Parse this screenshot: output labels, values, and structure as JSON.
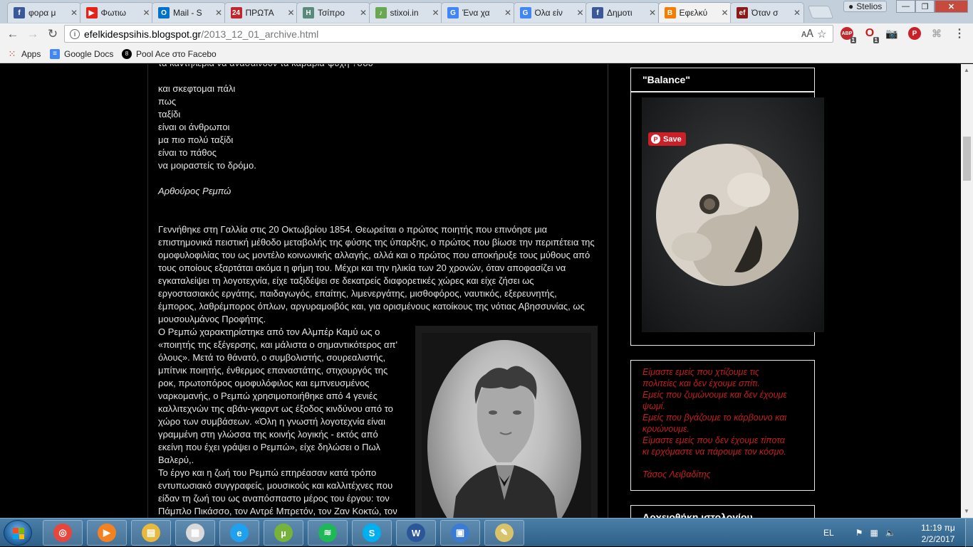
{
  "tabs": [
    {
      "label": "φορα μ",
      "icon": "f",
      "color": "#3b5998"
    },
    {
      "label": "Φωτιω",
      "icon": "▶",
      "color": "#e62117"
    },
    {
      "label": "Mail - S",
      "icon": "O",
      "color": "#0072c6"
    },
    {
      "label": "ΠΡΩΤΑ",
      "icon": "24",
      "color": "#c0262c"
    },
    {
      "label": "Τσίπρο",
      "icon": "H",
      "color": "#5a8a7a"
    },
    {
      "label": "stixoi.in",
      "icon": "♪",
      "color": "#6aa84f"
    },
    {
      "label": "Ένα χα",
      "icon": "G",
      "color": "#4285f4"
    },
    {
      "label": "Όλα είν",
      "icon": "G",
      "color": "#4285f4"
    },
    {
      "label": "Δημοτι",
      "icon": "f",
      "color": "#3b5998"
    },
    {
      "label": "Εφελκύ",
      "icon": "B",
      "color": "#f57d00",
      "active": true
    },
    {
      "label": "Όταν σ",
      "icon": "ef",
      "color": "#8b1a1a"
    }
  ],
  "profile_name": "Stelios",
  "address": {
    "host": "efelkidespsihis.blogspot.gr",
    "path": "/2013_12_01_archive.html"
  },
  "bookmarks": [
    {
      "label": "Apps",
      "icon": "apps-grid"
    },
    {
      "label": "Google Docs",
      "icon": "docs"
    },
    {
      "label": "Pool Ace στο Facebo",
      "icon": "8-ball"
    }
  ],
  "extension_badges": {
    "abp": "1",
    "opera": "1"
  },
  "post": {
    "cut_line": "τα καντηλέρια να ανασαίνουν τα καράβια-ψυχή ?σου",
    "poem_lines": [
      "και σκεφτομαι πάλι",
      "πως",
      "ταξίδι",
      "είναι οι άνθρωποι",
      "μα πιο πολύ ταξίδι",
      "είναι το πάθος",
      "να μοιραστείς το δρόμο."
    ],
    "author": "Αρθούρος Ρεμπώ",
    "bio_lines": [
      "Γεννήθηκε στη Γαλλία στις 20 Οκτωβρίου 1854. Θεωρείται ο πρώτος ποιητής που επινόησε μια",
      "επιστημονικά πειστική μέθοδο μεταβολής της φύσης της ύπαρξης, ο πρώτος που βίωσε την περιπέτεια της",
      "ομοφυλοφιλίας του ως μοντέλο κοινωνικής αλλαγής, αλλά και ο πρώτος που αποκήρυξε τους μύθους από",
      "τους οποίους εξαρτάται ακόμα η φήμη του. Μέχρι και την ηλικία των 20 χρονών, όταν αποφασίζει να",
      "εγκαταλείψει τη λογοτεχνία, είχε ταξιδέψει σε δεκατρείς διαφορετικές χώρες και είχε ζήσει ως",
      "εργοστασιακός εργάτης, παιδαγωγός, επαίτης, λιμενεργάτης, μισθοφόρος, ναυτικός, εξερευνητής,",
      "έμπορος, λαθρέμπορος όπλων, αργυραμοιβός και, για ορισμένους κατοίκους της νότιας Αβησσυνίας, ως",
      "μουσουλμάνος Προφήτης."
    ],
    "wrap_lines": [
      "Ο Ρεμπώ χαρακτηρίστηκε από τον Αλμπέρ Καμύ ως ο",
      "«ποιητής της εξέγερσης, και μάλιστα ο σημαντικότερος απ'",
      "όλους». Μετά το θάνατό, ο συμβολιστής, σουρεαλιστής,",
      "μπίτνικ ποιητής, ένθερμος επαναστάτης, στιχουργός της",
      "ροκ, πρωτοπόρος ομοφυλόφιλος και εμπνευσμένος",
      "ναρκομανής, ο Ρεμπώ χρησιμοποιήθηκε από 4 γενιές",
      "καλλιτεχνών της αβάν-γκαρντ ως έξοδος κινδύνου από το",
      "χώρο των συμβάσεων. «Όλη η γνωστή λογοτεχνία είναι",
      "γραμμένη στη γλώσσα της κοινής λογικής - εκτός από",
      "εκείνη που έχει γράψει ο Ρεμπώ», είχε δηλώσει ο Πωλ",
      "Βαλερύ,.",
      "Το έργο και η ζωή του Ρεμπώ επηρέασαν κατά τρόπο",
      "εντυπωσιακό συγγραφείς, μουσικούς και καλλιτέχνες που",
      "είδαν τη ζωή του ως αναπόσπαστο μέρος του έργου: τον",
      "Πάμπλο Πικάσσο, τον Αντρέ Μπρετόν, τον Ζαν Κοκτώ, τον"
    ]
  },
  "sidebar": {
    "balance_title": "\"Balance\"",
    "pin_save_label": "Save",
    "quote_lines": [
      "Είμαστε εμείς που χτίζουμε τις",
      "πολιτείες και δεν έχουμε σπίτι.",
      "Εμείς που ζυμώνουμε και δεν έχουμε",
      "ψωμί.",
      "Εμείς που βγάζουμε το κάρβουνο και",
      "κρυώνουμε.",
      "Είμαστε εμείς που δεν έχουμε τίποτα",
      "κι ερχόμαστε να πάρουμε τον κόσμο."
    ],
    "quote_author": "Τάσος Λειβαδίτης",
    "archive_title": "Αρχειοθήκη ιστολογίου"
  },
  "taskbar": {
    "apps": [
      "chrome",
      "media-player",
      "explorer",
      "app-grid",
      "internet-explorer",
      "utorrent",
      "spotify",
      "skype",
      "word",
      "photo-viewer",
      "paint"
    ],
    "language": "EL",
    "time": "11:19 πμ",
    "date": "2/2/2017"
  },
  "colors": {
    "page_bg": "#000000",
    "post_text": "#e6e6e6",
    "quote_text": "#c61d1d",
    "pinterest": "#cb2027"
  }
}
